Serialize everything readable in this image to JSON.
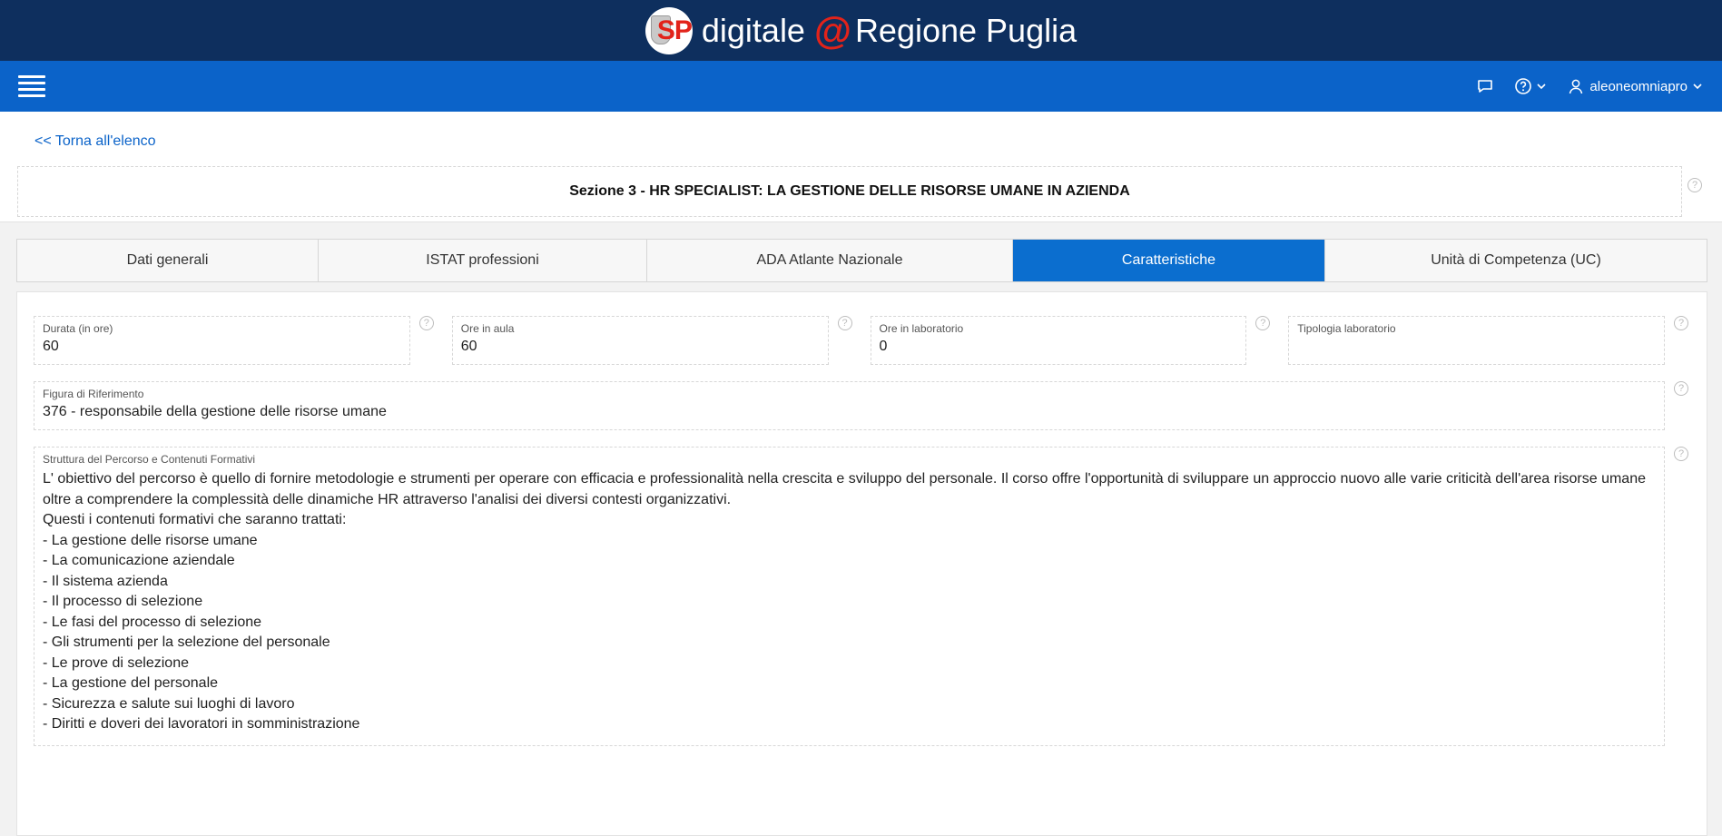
{
  "brand": {
    "logo_text": "SP",
    "name_left": "digitale",
    "at": "@",
    "name_right": "Regione Puglia"
  },
  "nav": {
    "user": "aleoneomniapro"
  },
  "header": {
    "back_link": "<< Torna all'elenco",
    "title": "Sezione 3 - HR SPECIALIST: LA GESTIONE DELLE RISORSE UMANE IN AZIENDA"
  },
  "tabs": [
    {
      "label": "Dati generali",
      "active": false
    },
    {
      "label": "ISTAT professioni",
      "active": false
    },
    {
      "label": "ADA Atlante Nazionale",
      "active": false
    },
    {
      "label": "Caratteristiche",
      "active": true
    },
    {
      "label": "Unità di Competenza (UC)",
      "active": false
    }
  ],
  "fields": {
    "durata": {
      "label": "Durata (in ore)",
      "value": "60"
    },
    "ore_aula": {
      "label": "Ore in aula",
      "value": "60"
    },
    "ore_laboratorio": {
      "label": "Ore in laboratorio",
      "value": "0"
    },
    "tipologia_laboratorio": {
      "label": "Tipologia laboratorio",
      "value": ""
    },
    "figura_riferimento": {
      "label": "Figura di Riferimento",
      "value": "376 - responsabile della gestione delle risorse umane"
    },
    "struttura": {
      "label": "Struttura del Percorso e Contenuti Formativi",
      "lines": [
        "L' obiettivo del percorso è quello di fornire metodologie e strumenti per operare con efficacia e professionalità nella crescita e sviluppo del personale. Il corso offre l'opportunità di sviluppare un approccio nuovo alle varie criticità dell'area risorse umane",
        "oltre a comprendere la complessità delle dinamiche HR attraverso l'analisi dei diversi contesti organizzativi.",
        "Questi i contenuti formativi che saranno trattati:",
        "- La gestione delle risorse umane",
        "- La comunicazione aziendale",
        "- Il sistema azienda",
        "- Il processo di selezione",
        "- Le fasi del processo di selezione",
        "- Gli strumenti per la selezione del personale",
        "- Le prove di selezione",
        "- La gestione del personale",
        "- Sicurezza e salute sui luoghi di lavoro",
        "- Diritti e doveri dei lavoratori in somministrazione"
      ]
    }
  },
  "colors": {
    "brand_bar": "#0e2f5e",
    "nav_bar": "#0b63c9",
    "active_tab": "#0b6ecf",
    "logo_accent": "#e2231a"
  },
  "icons": {
    "menu": "hamburger-icon",
    "chat": "chat-icon",
    "help": "question-circle-icon",
    "user": "user-icon",
    "chevron": "chevron-down-icon"
  }
}
